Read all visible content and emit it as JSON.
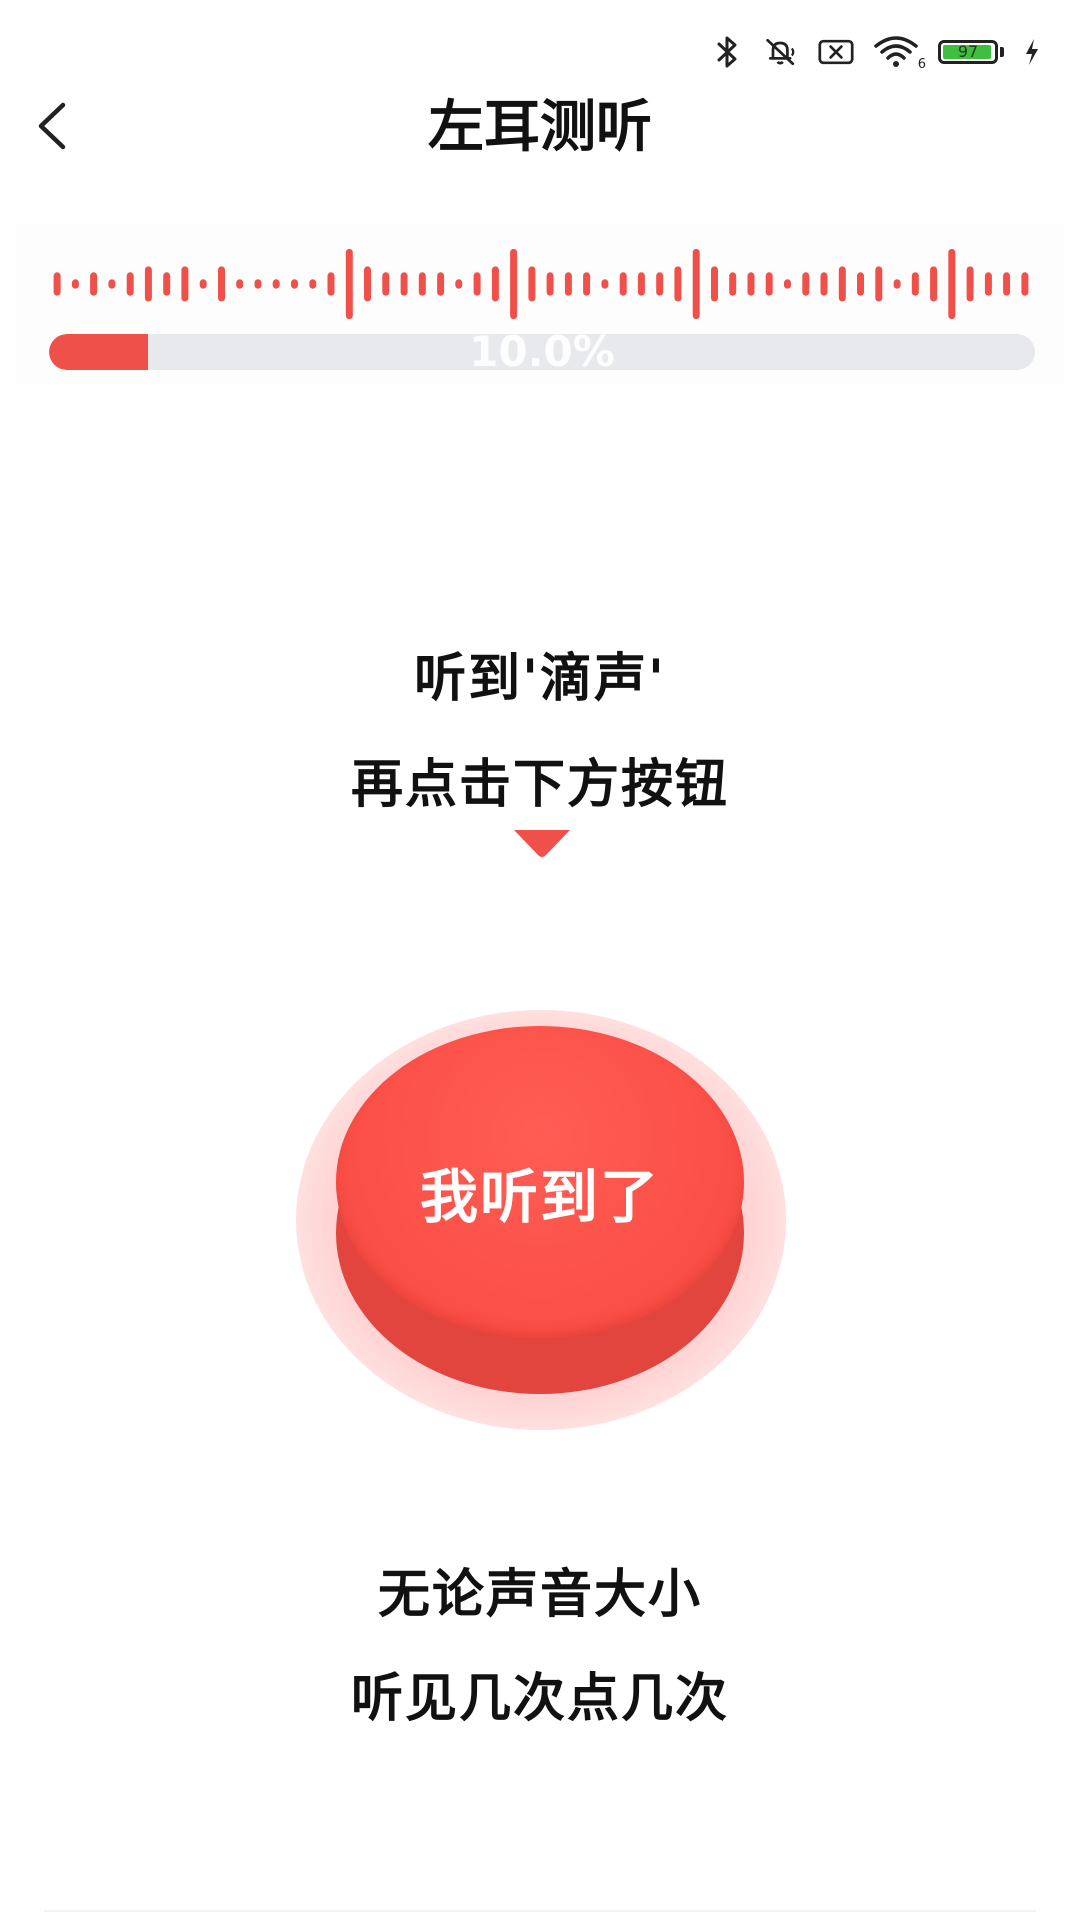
{
  "status_bar": {
    "icons": [
      "bluetooth-icon",
      "muted-bell-icon",
      "sim-x-icon",
      "wifi-icon",
      "charging-bolt-icon"
    ],
    "wifi_badge": "6",
    "battery_level": "97",
    "battery_fill_fraction": 0.97,
    "battery_color": "#3fbf3f"
  },
  "header": {
    "title": "左耳测听"
  },
  "progress": {
    "percent_label": "10.0%",
    "fraction": 0.1,
    "color": "#f0504a",
    "track_color": "#e8e9ec"
  },
  "waveform": {
    "color": "#f0504a",
    "bars": [
      0.3,
      0.12,
      0.3,
      0.12,
      0.3,
      0.45,
      0.3,
      0.45,
      0.12,
      0.45,
      0.12,
      0.12,
      0.12,
      0.12,
      0.12,
      0.3,
      0.9,
      0.45,
      0.3,
      0.3,
      0.3,
      0.3,
      0.12,
      0.3,
      0.45,
      0.9,
      0.45,
      0.3,
      0.3,
      0.3,
      0.12,
      0.3,
      0.3,
      0.3,
      0.45,
      0.9,
      0.45,
      0.3,
      0.3,
      0.3,
      0.12,
      0.3,
      0.3,
      0.45,
      0.3,
      0.45,
      0.12,
      0.3,
      0.45,
      0.9,
      0.45,
      0.3,
      0.3,
      0.3
    ]
  },
  "instructions": {
    "line1": "听到'滴声'",
    "line2": "再点击下方按钮"
  },
  "main_button": {
    "label": "我听到了",
    "color": "#fb5047"
  },
  "hints": {
    "line1": "无论声音大小",
    "line2": "听见几次点几次"
  }
}
